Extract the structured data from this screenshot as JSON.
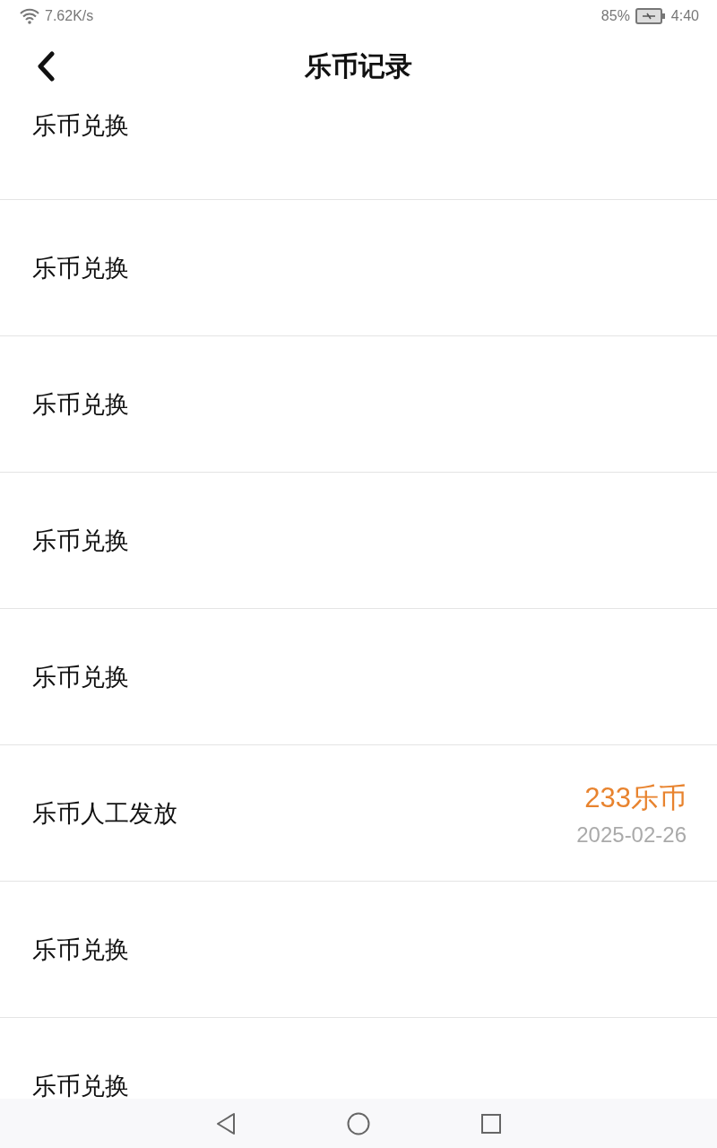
{
  "status_bar": {
    "network_speed": "7.62K/s",
    "battery": "85%",
    "time": "4:40"
  },
  "header": {
    "title": "乐币记录"
  },
  "records": [
    {
      "title": "乐币兑换"
    },
    {
      "title": "乐币兑换"
    },
    {
      "title": "乐币兑换"
    },
    {
      "title": "乐币兑换"
    },
    {
      "title": "乐币兑换"
    },
    {
      "title": "乐币人工发放",
      "amount": "233乐币",
      "date": "2025-02-26"
    },
    {
      "title": "乐币兑换"
    },
    {
      "title": "乐币兑换"
    }
  ]
}
